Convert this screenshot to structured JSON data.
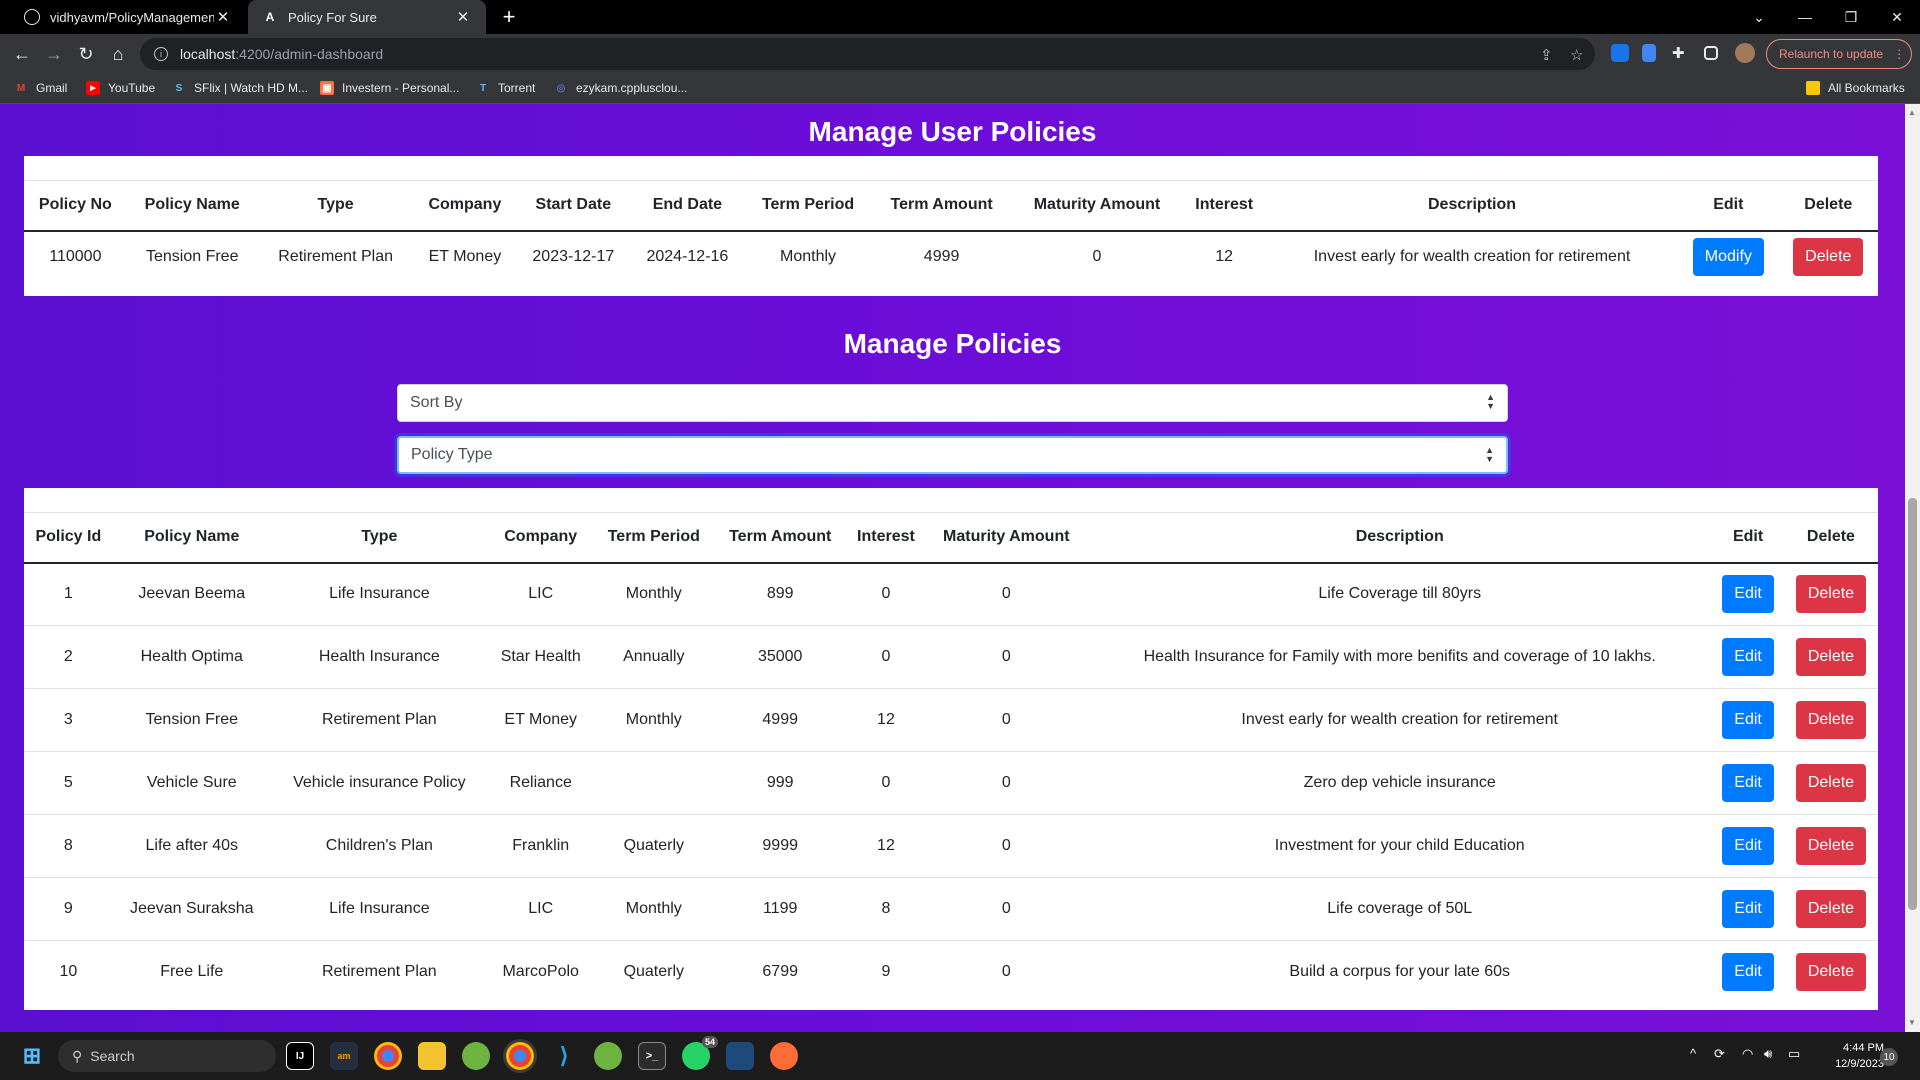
{
  "browser": {
    "tabs": [
      {
        "title": "vidhyavm/PolicyManagement_P",
        "icon": "github-icon"
      },
      {
        "title": "Policy For Sure",
        "icon": "angular-icon"
      }
    ],
    "new_tab_label": "+",
    "url_host": "localhost",
    "url_path": ":4200/admin-dashboard",
    "relaunch_label": "Relaunch to update",
    "bookmarks": [
      {
        "label": "Gmail",
        "icon": "gmail-icon"
      },
      {
        "label": "YouTube",
        "icon": "youtube-icon"
      },
      {
        "label": "SFlix | Watch HD M...",
        "icon": "sflix-icon"
      },
      {
        "label": "Investern - Personal...",
        "icon": "investern-icon"
      },
      {
        "label": "Torrent",
        "icon": "torrent-icon"
      },
      {
        "label": "ezykam.cpplusclou...",
        "icon": "ezykam-icon"
      }
    ],
    "all_bookmarks_label": "All Bookmarks"
  },
  "user_policies": {
    "title": "Manage User Policies",
    "columns": [
      "Policy No",
      "Policy Name",
      "Type",
      "Company",
      "Start Date",
      "End Date",
      "Term Period",
      "Term Amount",
      "Maturity Amount",
      "Interest",
      "Description",
      "Edit",
      "Delete"
    ],
    "rows": [
      {
        "policy_no": "110000",
        "name": "Tension Free",
        "type": "Retirement Plan",
        "company": "ET Money",
        "start": "2023-12-17",
        "end": "2024-12-16",
        "period": "Monthly",
        "amount": "4999",
        "maturity": "0",
        "interest": "12",
        "description": "Invest early for wealth creation for retirement",
        "edit_label": "Modify",
        "delete_label": "Delete"
      }
    ]
  },
  "policies": {
    "title": "Manage Policies",
    "sort_select": "Sort By",
    "type_select": "Policy Type",
    "columns": [
      "Policy Id",
      "Policy Name",
      "Type",
      "Company",
      "Term Period",
      "Term Amount",
      "Interest",
      "Maturity Amount",
      "Description",
      "Edit",
      "Delete"
    ],
    "rows": [
      {
        "id": "1",
        "name": "Jeevan Beema",
        "type": "Life Insurance",
        "company": "LIC",
        "period": "Monthly",
        "amount": "899",
        "interest": "0",
        "maturity": "0",
        "description": "Life Coverage till 80yrs",
        "edit_label": "Edit",
        "delete_label": "Delete"
      },
      {
        "id": "2",
        "name": "Health Optima",
        "type": "Health Insurance",
        "company": "Star Health",
        "period": "Annually",
        "amount": "35000",
        "interest": "0",
        "maturity": "0",
        "description": "Health Insurance for Family with more benifits and coverage of 10 lakhs.",
        "edit_label": "Edit",
        "delete_label": "Delete"
      },
      {
        "id": "3",
        "name": "Tension Free",
        "type": "Retirement Plan",
        "company": "ET Money",
        "period": "Monthly",
        "amount": "4999",
        "interest": "12",
        "maturity": "0",
        "description": "Invest early for wealth creation for retirement",
        "edit_label": "Edit",
        "delete_label": "Delete"
      },
      {
        "id": "5",
        "name": "Vehicle Sure",
        "type": "Vehicle insurance Policy",
        "company": "Reliance",
        "period": "",
        "amount": "999",
        "interest": "0",
        "maturity": "0",
        "description": "Zero dep vehicle insurance",
        "edit_label": "Edit",
        "delete_label": "Delete"
      },
      {
        "id": "8",
        "name": "Life after 40s",
        "type": "Children's Plan",
        "company": "Franklin",
        "period": "Quaterly",
        "amount": "9999",
        "interest": "12",
        "maturity": "0",
        "description": "Investment for your child Education",
        "edit_label": "Edit",
        "delete_label": "Delete"
      },
      {
        "id": "9",
        "name": "Jeevan Suraksha",
        "type": "Life Insurance",
        "company": "LIC",
        "period": "Monthly",
        "amount": "1199",
        "interest": "8",
        "maturity": "0",
        "description": "Life coverage of 50L",
        "edit_label": "Edit",
        "delete_label": "Delete"
      },
      {
        "id": "10",
        "name": "Free Life",
        "type": "Retirement Plan",
        "company": "MarcoPolo",
        "period": "Quaterly",
        "amount": "6799",
        "interest": "9",
        "maturity": "0",
        "description": "Build a corpus for your late 60s",
        "edit_label": "Edit",
        "delete_label": "Delete"
      }
    ]
  },
  "taskbar": {
    "search_label": "Search",
    "whatsapp_badge": "54",
    "time": "4:44 PM",
    "date": "12/9/2023",
    "notification_count": "10"
  },
  "colors": {
    "primary_button": "#007bff",
    "danger_button": "#dc3545",
    "page_gradient_start": "#5a0fd0",
    "page_gradient_end": "#7a10d6"
  }
}
